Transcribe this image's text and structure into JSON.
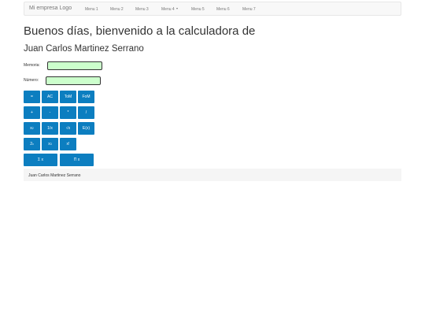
{
  "navbar": {
    "brand": "Mi empresa Logo",
    "menu": [
      "Menu 1",
      "Menu 2",
      "Menu 3",
      "Menu 4",
      "Menu 5",
      "Menu 6",
      "Menu 7"
    ]
  },
  "heading": {
    "line1": "Buenos días, bienvenido a la calculadora de",
    "line2": "Juan Carlos Martinez Serrano"
  },
  "form": {
    "memoria_label": "Memoria:",
    "memoria_value": "",
    "numero_label": "Número:",
    "numero_value": ""
  },
  "buttons": {
    "equals": "=",
    "ac": "AC",
    "tom": "ToM",
    "fom": "FoM",
    "plus": "+",
    "minus": "-",
    "multiply": "*",
    "divide": "/",
    "square_base": "x",
    "square_exp": "2",
    "reciprocal": "1/x",
    "sqrt": "√x",
    "exp": "E(x)",
    "pow2_base": "2",
    "pow2_exp": "x",
    "cube_base": "x",
    "cube_exp": "3",
    "factorial": "x!",
    "sum": "Σ x",
    "product": "Π x"
  },
  "footer": {
    "text": "Juan Carlos Martinez Serrano"
  },
  "colors": {
    "button_blue": "#0c7ec0",
    "field_green": "#ccffcc",
    "navbar_bg": "#f8f8f8",
    "footer_bg": "#f5f5f5"
  }
}
